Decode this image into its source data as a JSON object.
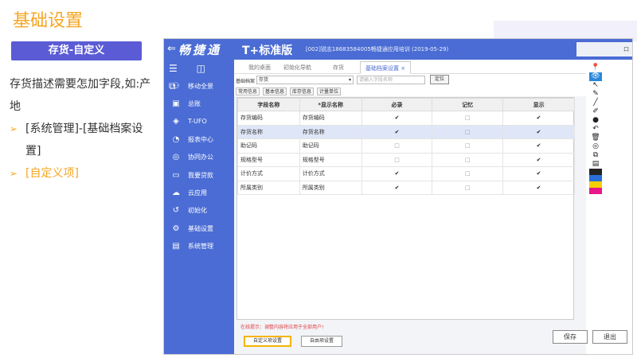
{
  "slide": {
    "title": "基础设置",
    "badge": "存货-自定义",
    "bullets": [
      {
        "text": "存货描述需要怎加字段,如:产地",
        "arrow": ""
      },
      {
        "text": "[系统管理]-[基础档案设置]",
        "arrow": "➢"
      },
      {
        "text": "[自定义项]",
        "arrow": "➢"
      }
    ]
  },
  "app": {
    "back": "⇐",
    "logo": "畅捷通",
    "brand": "T+标准版",
    "info": "[002]锐志18683584005畅捷通应用培训  (2019-05-29)",
    "window_control": "口",
    "sidebar": {
      "tools": "☰ ◫ ⧉",
      "items": [
        {
          "icon": "⚇",
          "label": "移动全景"
        },
        {
          "icon": "▣",
          "label": "总账"
        },
        {
          "icon": "◈",
          "label": "T-UFO"
        },
        {
          "icon": "◔",
          "label": "报表中心"
        },
        {
          "icon": "◎",
          "label": "协同办公"
        },
        {
          "icon": "▭",
          "label": "我要贷款"
        },
        {
          "icon": "☁",
          "label": "云应用"
        },
        {
          "icon": "↺",
          "label": "初始化"
        },
        {
          "icon": "⚙",
          "label": "基础设置"
        },
        {
          "icon": "▤",
          "label": "系统管理"
        }
      ]
    },
    "tabs": [
      "我的桌面",
      "初始化导航",
      "存货",
      "基础档案设置 ×"
    ],
    "filter": {
      "label": "基础档案",
      "select_value": "存货",
      "select_arrow": "▾",
      "search_placeholder": "请输入字段名称",
      "locate_button": "定位"
    },
    "subtabs": [
      "常用信息",
      "基本信息",
      "库存信息",
      "计量单位"
    ],
    "grid": {
      "headers": [
        "字段名称",
        "*显示名称",
        "必录",
        "记忆",
        "显示"
      ],
      "check_mark": "✔",
      "empty_mark": "□",
      "rows": [
        {
          "field": "存货编码",
          "display": "存货编码",
          "required": true,
          "memory": false,
          "show": true
        },
        {
          "field": "存货名称",
          "display": "存货名称",
          "required": true,
          "memory": false,
          "show": true
        },
        {
          "field": "助记码",
          "display": "助记码",
          "required": false,
          "memory": false,
          "show": true
        },
        {
          "field": "规格型号",
          "display": "规格型号",
          "required": false,
          "memory": false,
          "show": true
        },
        {
          "field": "计价方式",
          "display": "计价方式",
          "required": true,
          "memory": false,
          "show": true
        },
        {
          "field": "所属类别",
          "display": "所属类别",
          "required": true,
          "memory": false,
          "show": true
        }
      ]
    },
    "hint": "在线提示：调整内容将应用于全部用户!",
    "custom_item_button": "自定义项设置",
    "auto_item_button": "自由项设置",
    "save_button": "保存",
    "exit_button": "退出"
  },
  "toolbar": {
    "pin": "📍",
    "items": [
      "👁",
      "↖",
      "✎",
      "╱",
      "✐",
      "●",
      "↶",
      "🗑",
      "◎",
      "⧉",
      "▤"
    ],
    "colors": [
      "#222222",
      "#2a6fd8",
      "#f5d000",
      "#e8178a"
    ]
  }
}
